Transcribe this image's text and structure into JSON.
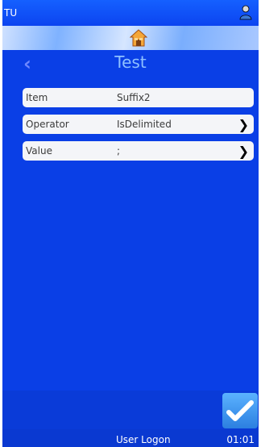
{
  "header": {
    "device_name": "TU",
    "user_icon": "user-icon",
    "home_icon": "home-icon"
  },
  "page": {
    "title": "Test",
    "back_icon": "chevron-left-icon"
  },
  "fields": [
    {
      "label": "Item",
      "value": "Suffix2",
      "has_chevron": false
    },
    {
      "label": "Operator",
      "value": "IsDelimited",
      "has_chevron": true
    },
    {
      "label": "Value",
      "value": ";",
      "has_chevron": true
    }
  ],
  "footer": {
    "status_text": "User Logon",
    "time": "01:01",
    "action_icon": "checkmark-icon"
  },
  "colors": {
    "background": "#0a3fe6",
    "title": "#8ec0ff",
    "row_background": "#f4f5f8"
  }
}
